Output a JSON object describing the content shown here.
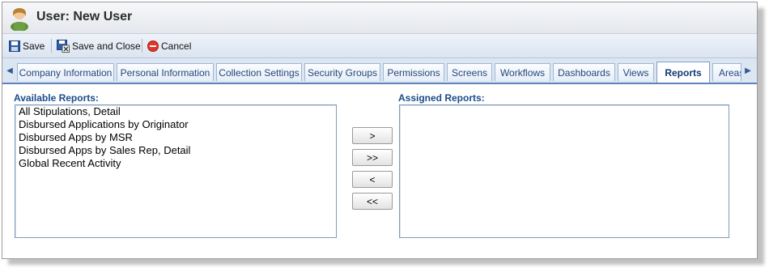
{
  "window": {
    "title": "User: New User"
  },
  "toolbar": {
    "save_label": "Save",
    "save_close_label": "Save and Close",
    "cancel_label": "Cancel"
  },
  "tabs": [
    {
      "label": "Company Information"
    },
    {
      "label": "Personal Information"
    },
    {
      "label": "Collection Settings"
    },
    {
      "label": "Security Groups"
    },
    {
      "label": "Permissions"
    },
    {
      "label": "Screens"
    },
    {
      "label": "Workflows"
    },
    {
      "label": "Dashboards"
    },
    {
      "label": "Views"
    },
    {
      "label": "Reports",
      "active": true
    },
    {
      "label": "Areas"
    }
  ],
  "available": {
    "label": "Available Reports:",
    "items": [
      "All Stipulations, Detail",
      "Disbursed Applications by Originator",
      "Disbursed Apps by MSR",
      "Disbursed Apps by Sales Rep, Detail",
      "Global Recent Activity"
    ]
  },
  "assigned": {
    "label": "Assigned Reports:",
    "items": []
  },
  "move_buttons": {
    "add": ">",
    "add_all": ">>",
    "remove": "<",
    "remove_all": "<<"
  },
  "colors": {
    "accent": "#1b4b8a",
    "tab_underline": "#5d83b8"
  },
  "icons": {
    "user": "user-icon",
    "save": "floppy-disk-icon",
    "save_close": "save-close-icon",
    "cancel": "cancel-icon",
    "scroll_left": "arrow-left-icon",
    "scroll_right": "arrow-right-icon"
  }
}
